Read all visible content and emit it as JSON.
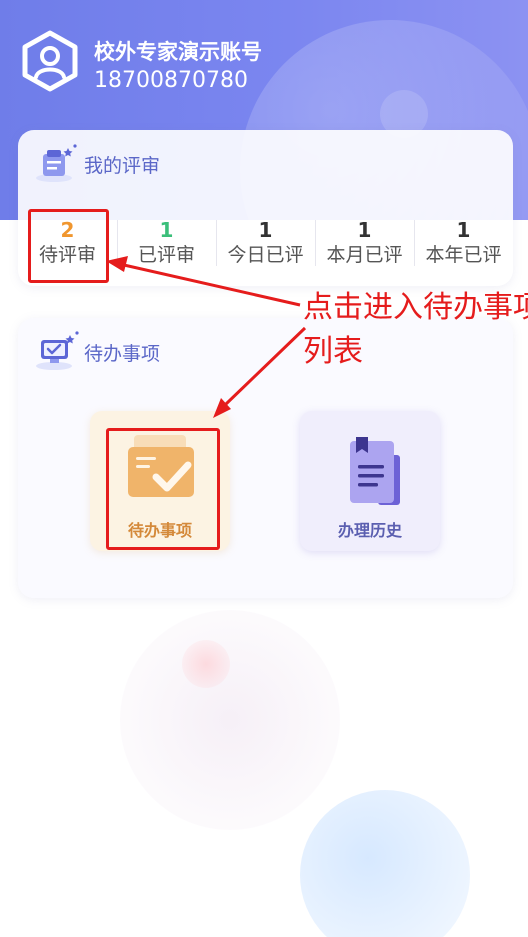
{
  "account": {
    "name": "校外专家演示账号",
    "phone": "18700870780"
  },
  "review_card": {
    "title": "我的评审",
    "stats": [
      {
        "value": "2",
        "label": "待评审",
        "color": "#f0962e"
      },
      {
        "value": "1",
        "label": "已评审",
        "color": "#3bbf7a"
      },
      {
        "value": "1",
        "label": "今日已评",
        "color": "#333333"
      },
      {
        "value": "1",
        "label": "本月已评",
        "color": "#333333"
      },
      {
        "value": "1",
        "label": "本年已评",
        "color": "#333333"
      }
    ]
  },
  "todo_card": {
    "title": "待办事项",
    "tiles": [
      {
        "label": "待办事项",
        "icon": "pending-card-icon"
      },
      {
        "label": "办理历史",
        "icon": "history-book-icon"
      }
    ]
  },
  "annotation": {
    "text": "点击进入待办事项列表",
    "color": "#e51c1c"
  },
  "colors": {
    "header_gradient_start": "#6f7de9",
    "header_gradient_end": "#8c92f2",
    "accent_title": "#5b67c8",
    "pending_orange": "#d4893a",
    "history_purple": "#5b5fb0"
  }
}
